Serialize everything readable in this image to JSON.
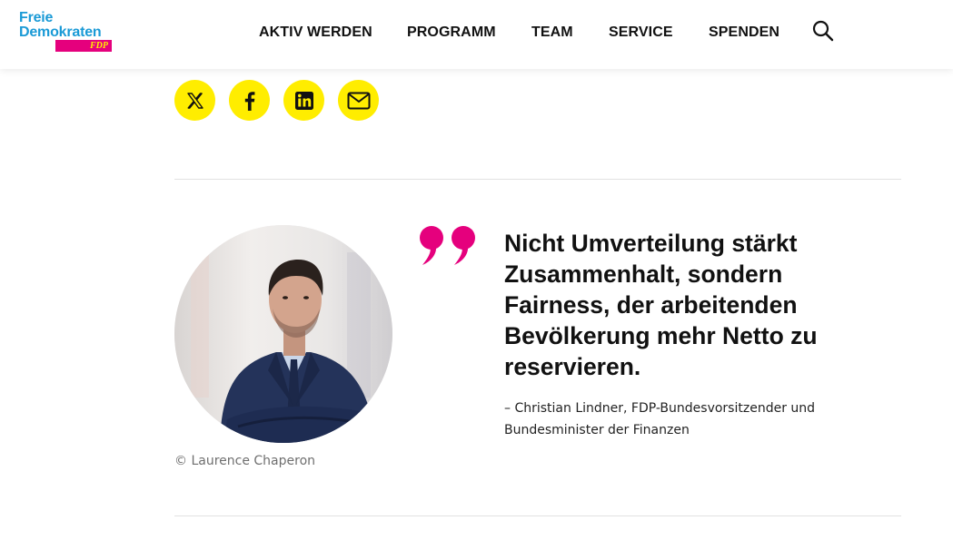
{
  "brand": {
    "line1": "Freie",
    "line2": "Demokraten",
    "badge": "FDP",
    "colors": {
      "blue": "#1a9ad6",
      "magenta": "#e5007d",
      "yellow": "#ffed00"
    }
  },
  "nav": {
    "items": [
      {
        "label": "AKTIV WERDEN"
      },
      {
        "label": "PROGRAMM"
      },
      {
        "label": "TEAM"
      },
      {
        "label": "SERVICE"
      },
      {
        "label": "SPENDEN"
      }
    ],
    "search_icon": "search-icon"
  },
  "share": {
    "buttons": [
      {
        "icon": "x-twitter-icon"
      },
      {
        "icon": "facebook-icon"
      },
      {
        "icon": "linkedin-icon"
      },
      {
        "icon": "mail-icon"
      }
    ]
  },
  "quote": {
    "text": "Nicht Umverteilung stärkt Zusammenhalt, sondern Fairness, der arbeitenden Bevölkerung mehr Netto zu reservieren.",
    "attribution": "– Christian Lindner, FDP-Bundesvorsitzender und Bundesminister der Finanzen",
    "image_credit": "© Laurence Chaperon",
    "quote_mark_color": "#e5007d"
  }
}
